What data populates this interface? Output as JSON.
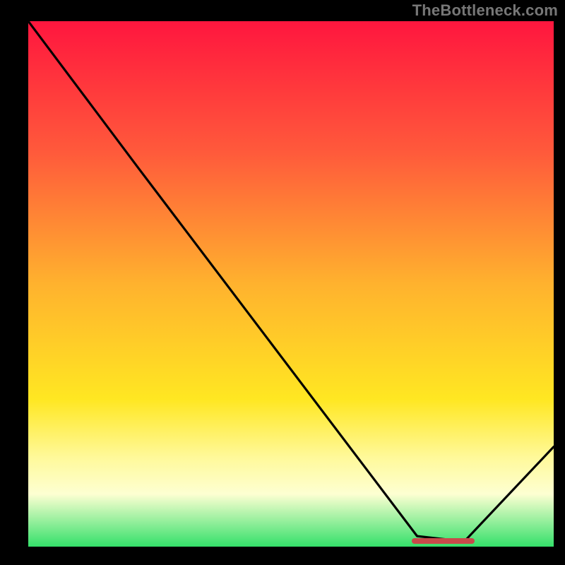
{
  "attribution": "TheBottleneck.com",
  "chart_data": {
    "type": "line",
    "title": "",
    "xlabel": "",
    "ylabel": "",
    "xlim": [
      0,
      100
    ],
    "ylim": [
      0,
      100
    ],
    "grid": false,
    "legend": false,
    "background_gradient": {
      "direction": "vertical",
      "stops": [
        {
          "pos": 0.0,
          "color": "#ff163e"
        },
        {
          "pos": 0.25,
          "color": "#ff5a3b"
        },
        {
          "pos": 0.5,
          "color": "#ffb22e"
        },
        {
          "pos": 0.72,
          "color": "#ffe722"
        },
        {
          "pos": 0.83,
          "color": "#fff99a"
        },
        {
          "pos": 0.9,
          "color": "#fdffd2"
        },
        {
          "pos": 1.0,
          "color": "#34e06a"
        }
      ]
    },
    "series": [
      {
        "name": "curve",
        "color": "#000000",
        "x": [
          0,
          21,
          74,
          83,
          100
        ],
        "y": [
          100,
          72,
          2,
          1,
          19
        ]
      }
    ],
    "marker": {
      "name": "highlight-segment",
      "color": "#c84a4a",
      "x_start": 73,
      "x_end": 85,
      "y": 1
    }
  }
}
